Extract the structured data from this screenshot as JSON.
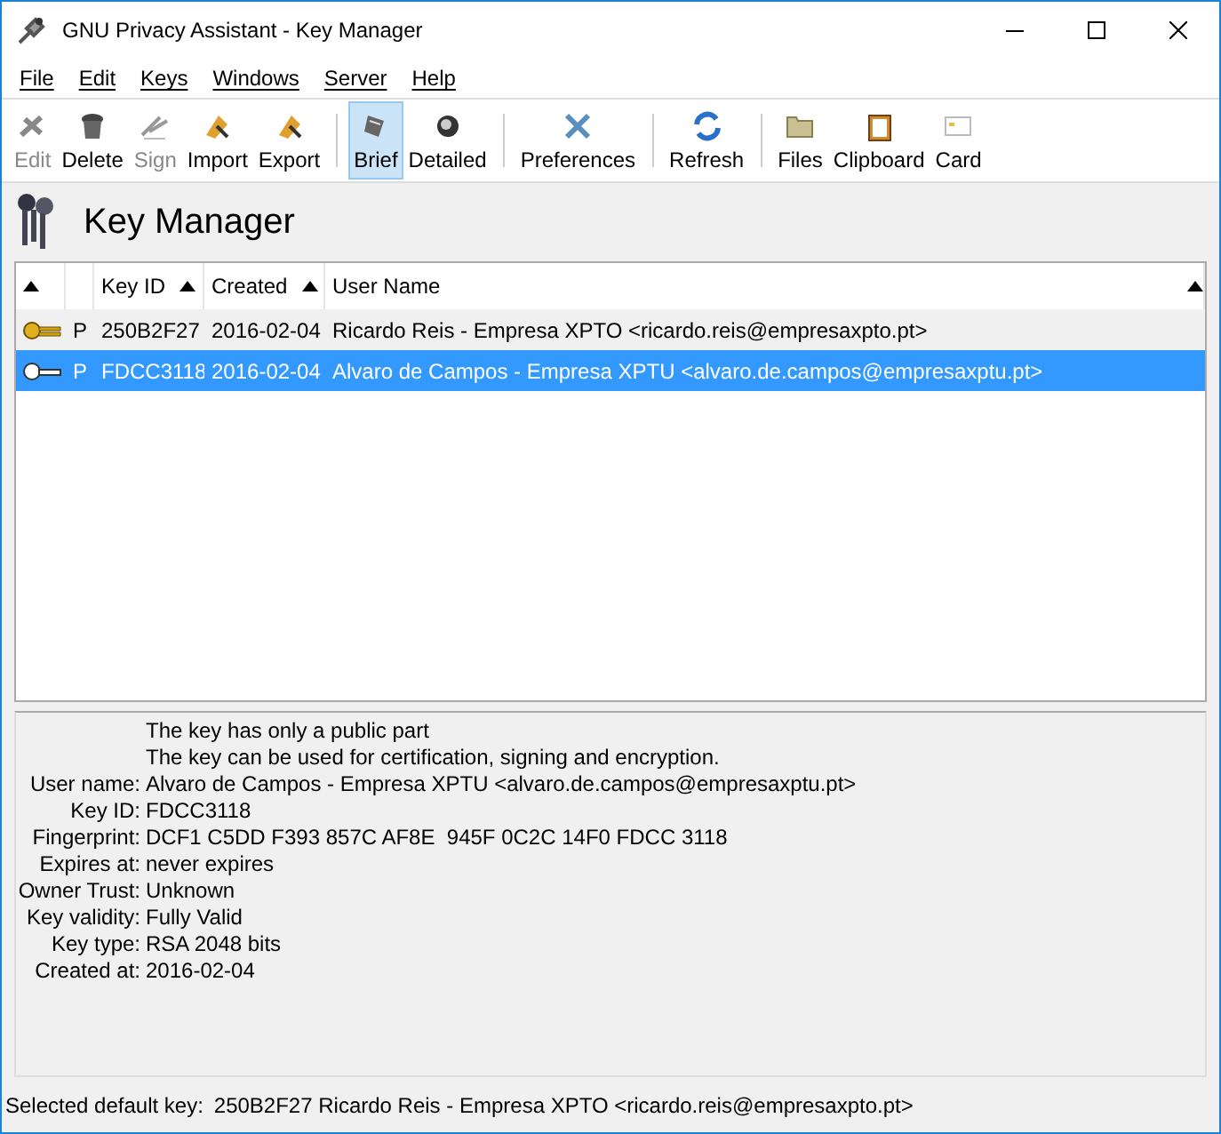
{
  "window": {
    "title": "GNU Privacy Assistant - Key Manager"
  },
  "menu": [
    "File",
    "Edit",
    "Keys",
    "Windows",
    "Server",
    "Help"
  ],
  "toolbar": [
    {
      "kind": "button",
      "label": "Edit",
      "disabled": true,
      "selected": false
    },
    {
      "kind": "button",
      "label": "Delete",
      "disabled": false,
      "selected": false
    },
    {
      "kind": "button",
      "label": "Sign",
      "disabled": true,
      "selected": false
    },
    {
      "kind": "button",
      "label": "Import",
      "disabled": false,
      "selected": false
    },
    {
      "kind": "button",
      "label": "Export",
      "disabled": false,
      "selected": false
    },
    {
      "kind": "separator"
    },
    {
      "kind": "button",
      "label": "Brief",
      "disabled": false,
      "selected": true
    },
    {
      "kind": "button",
      "label": "Detailed",
      "disabled": false,
      "selected": false
    },
    {
      "kind": "separator"
    },
    {
      "kind": "button",
      "label": "Preferences",
      "disabled": false,
      "selected": false
    },
    {
      "kind": "separator"
    },
    {
      "kind": "button",
      "label": "Refresh",
      "disabled": false,
      "selected": false
    },
    {
      "kind": "separator"
    },
    {
      "kind": "button",
      "label": "Files",
      "disabled": false,
      "selected": false
    },
    {
      "kind": "button",
      "label": "Clipboard",
      "disabled": false,
      "selected": false
    },
    {
      "kind": "button",
      "label": "Card",
      "disabled": false,
      "selected": false
    }
  ],
  "heading": "Key Manager",
  "table": {
    "columns": [
      "",
      "",
      "Key ID",
      "Created",
      "User Name"
    ],
    "rows": [
      {
        "kind": "pair",
        "type": "P",
        "key_id": "250B2F27",
        "created": "2016-02-04",
        "user_name": "Ricardo Reis - Empresa XPTO <ricardo.reis@empresaxpto.pt>",
        "selected": false
      },
      {
        "kind": "public",
        "type": "P",
        "key_id": "FDCC3118",
        "created": "2016-02-04",
        "user_name": "Alvaro de Campos - Empresa XPTU <alvaro.de.campos@empresaxptu.pt>",
        "selected": true
      }
    ]
  },
  "details": {
    "notes": [
      "The key has only a public part",
      "The key can be used for certification, signing and encryption."
    ],
    "fields": [
      {
        "label": "User name:",
        "value": "Alvaro de Campos - Empresa XPTU <alvaro.de.campos@empresaxptu.pt>"
      },
      {
        "label": "Key ID:",
        "value": "FDCC3118"
      },
      {
        "label": "Fingerprint:",
        "value": "DCF1 C5DD F393 857C AF8E  945F 0C2C 14F0 FDCC 3118"
      },
      {
        "label": "Expires at:",
        "value": "never expires"
      },
      {
        "label": "Owner Trust:",
        "value": "Unknown"
      },
      {
        "label": "Key validity:",
        "value": "Fully Valid"
      },
      {
        "label": "Key type:",
        "value": "RSA 2048 bits"
      },
      {
        "label": "Created at:",
        "value": "2016-02-04"
      }
    ]
  },
  "status_bar": {
    "label": "Selected default key:",
    "value": "250B2F27 Ricardo Reis - Empresa XPTO <ricardo.reis@empresaxpto.pt>"
  }
}
